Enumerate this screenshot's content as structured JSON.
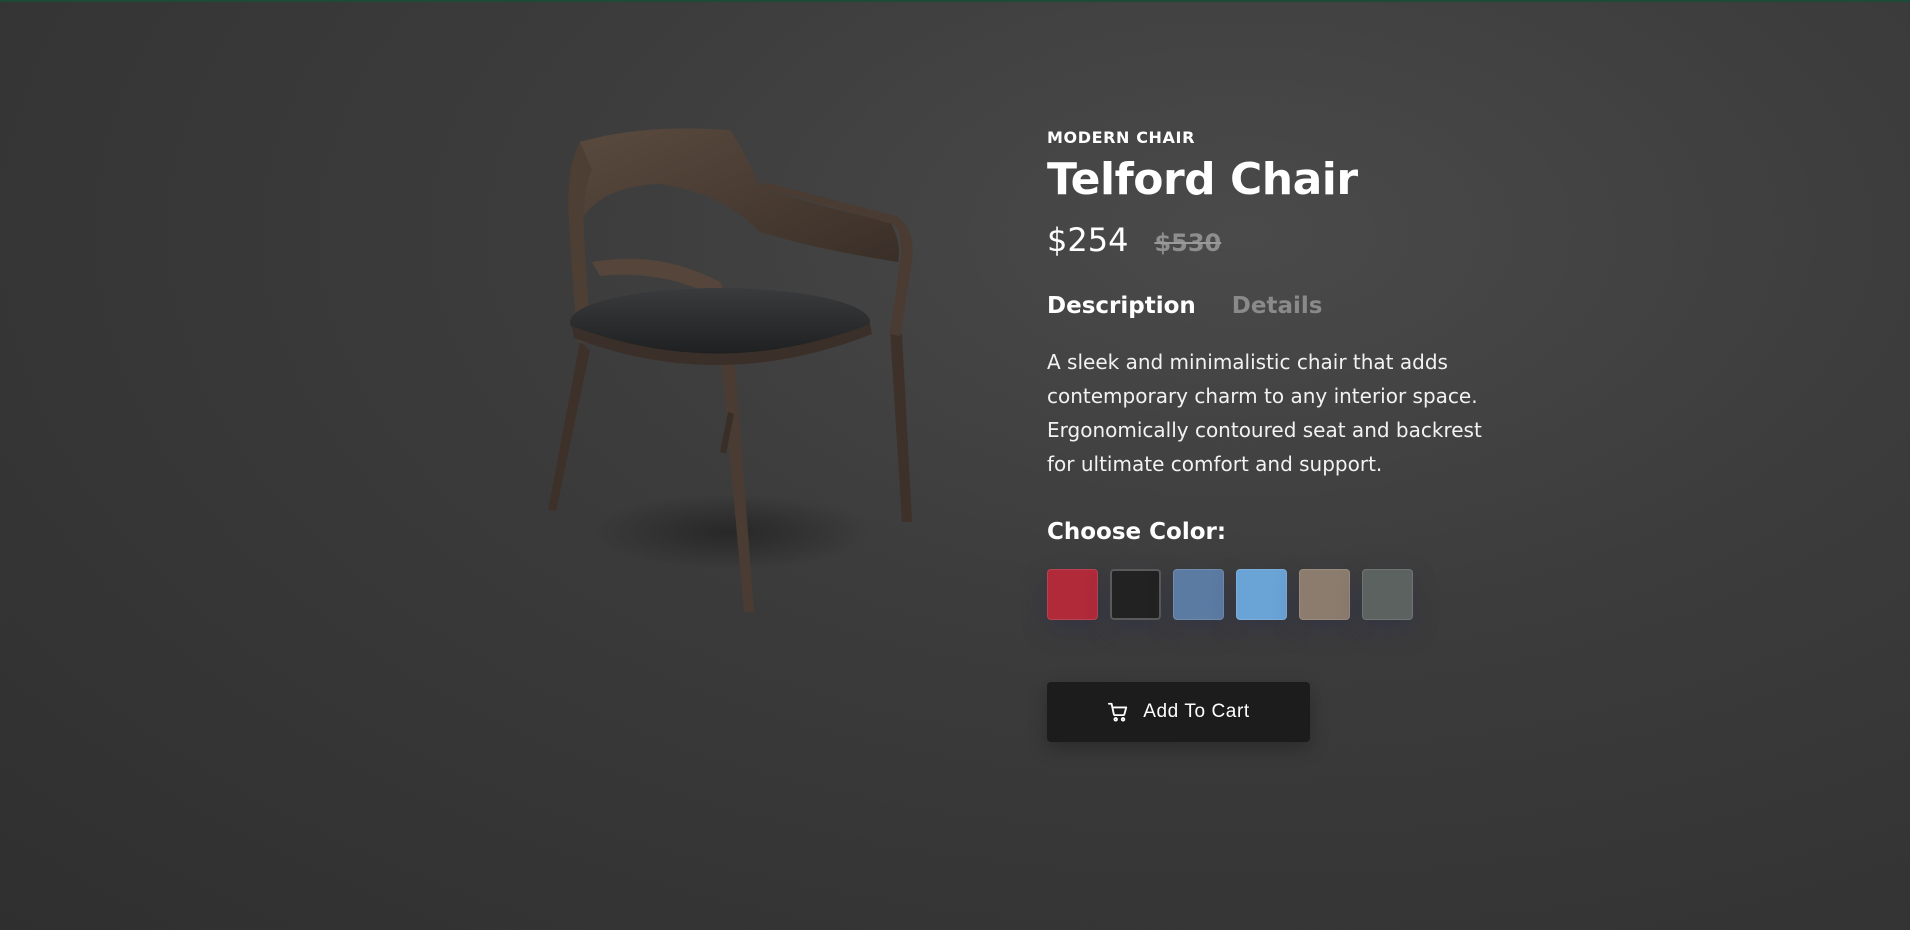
{
  "product": {
    "category": "MODERN CHAIR",
    "name": "Telford Chair",
    "price": "$254",
    "old_price": "$530",
    "image_icon": "chair-product-image"
  },
  "tabs": [
    {
      "label": "Description",
      "active": true
    },
    {
      "label": "Details",
      "active": false
    }
  ],
  "description": "A sleek and minimalistic chair that adds contemporary charm to any interior space. Ergonomically contoured seat and backrest for ultimate comfort and support.",
  "color_picker": {
    "label": "Choose Color:",
    "swatches": [
      {
        "color": "#b02a3a",
        "selected": false
      },
      {
        "color": "#222222",
        "selected": true
      },
      {
        "color": "#5c7ba3",
        "selected": false
      },
      {
        "color": "#6aa3d6",
        "selected": false
      },
      {
        "color": "#8c7c6e",
        "selected": false
      },
      {
        "color": "#5b6260",
        "selected": false
      }
    ]
  },
  "cart_button": {
    "label": "Add To Cart",
    "icon": "cart-icon"
  },
  "colors": {
    "background": "#3a3a3a",
    "button": "#1c1c1c",
    "muted_text": "#8a8a8a"
  }
}
